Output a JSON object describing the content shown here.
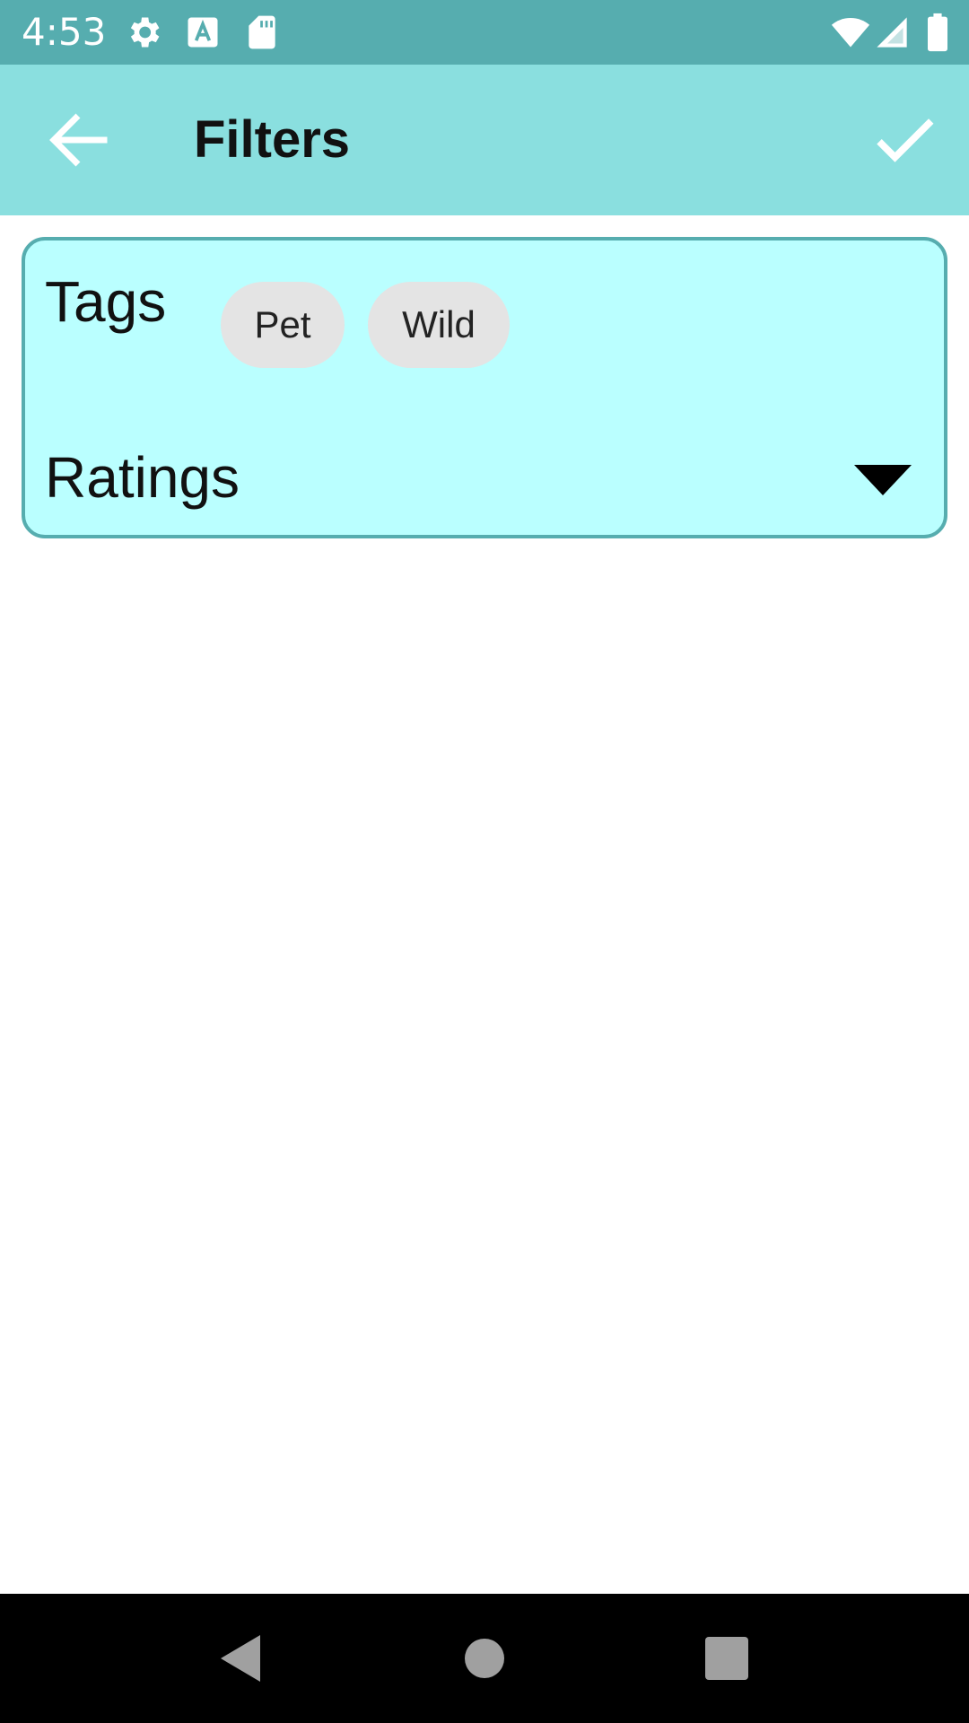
{
  "status_bar": {
    "time": "4:53",
    "left_icons": [
      "settings-gear-icon",
      "text-a-icon",
      "sd-card-icon"
    ],
    "right_icons": [
      "wifi-icon",
      "cell-signal-icon",
      "battery-icon"
    ]
  },
  "app_bar": {
    "title": "Filters",
    "back_icon": "arrow-back-icon",
    "confirm_icon": "check-icon",
    "background": "#8adfdf"
  },
  "filter_card": {
    "tags_label": "Tags",
    "tags": [
      "Pet",
      "Wild"
    ],
    "ratings_label": "Ratings",
    "ratings_icon": "dropdown-arrow-icon",
    "background": "#baffff",
    "border_color": "#56adaf"
  },
  "nav_bar": {
    "buttons": [
      "nav-back-icon",
      "nav-home-icon",
      "nav-recents-icon"
    ]
  },
  "colors": {
    "status_bar": "#56adaf",
    "chip": "#e4e4e4"
  }
}
